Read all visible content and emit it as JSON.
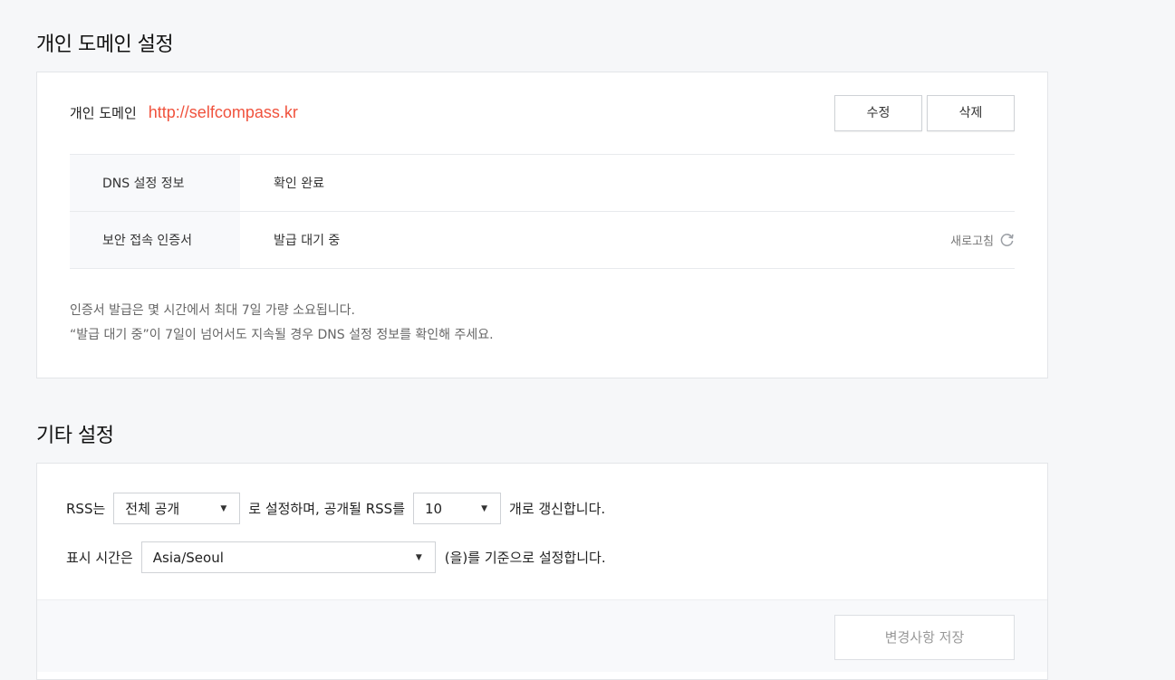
{
  "domain_section": {
    "title": "개인 도메인 설정",
    "label": "개인 도메인",
    "url": "http://selfcompass.kr",
    "edit_label": "수정",
    "delete_label": "삭제",
    "rows": [
      {
        "key": "DNS 설정 정보",
        "value": "확인 완료"
      },
      {
        "key": "보안 접속 인증서",
        "value": "발급 대기 중"
      }
    ],
    "refresh_label": "새로고침",
    "note_lines": [
      "인증서 발급은 몇 시간에서 최대 7일 가량 소요됩니다.",
      "“발급 대기 중”이 7일이 넘어서도 지속될 경우 DNS 설정 정보를 확인해 주세요."
    ]
  },
  "other_section": {
    "title": "기타 설정",
    "rss_prefix": "RSS는",
    "rss_select": "전체 공개",
    "rss_middle": "로 설정하며, 공개될 RSS를",
    "rss_count": "10",
    "rss_suffix": "개로 갱신합니다.",
    "tz_prefix": "표시 시간은",
    "tz_select": "Asia/Seoul",
    "tz_suffix": "(을)를 기준으로 설정합니다.",
    "save_label": "변경사항 저장"
  },
  "colors": {
    "accent": "#f0523d",
    "background": "#f6f7f9"
  },
  "icons": {
    "refresh": "refresh-icon",
    "dropdown": "caret-down-icon"
  }
}
